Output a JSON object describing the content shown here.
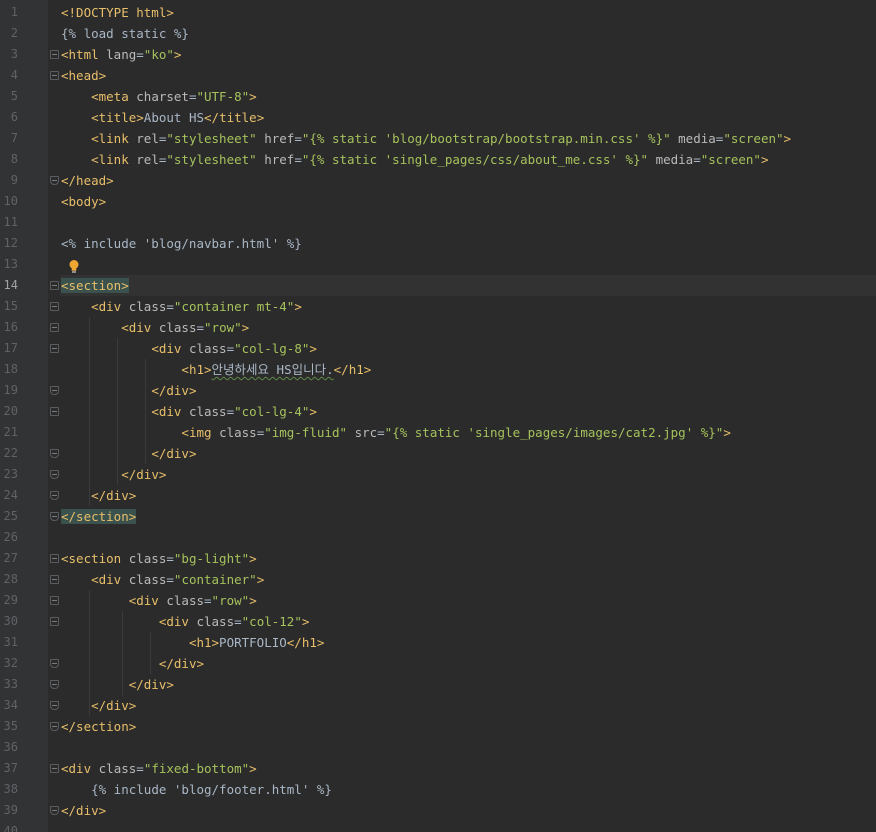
{
  "editor": {
    "current_line": 14,
    "lines": [
      {
        "n": "1",
        "tokens": [
          {
            "t": "<!DOCTYPE html>",
            "c": "tag"
          }
        ]
      },
      {
        "n": "2",
        "tokens": [
          {
            "t": "{% load static %}",
            "c": "tpl"
          }
        ]
      },
      {
        "n": "3",
        "tokens": [
          {
            "t": "<html ",
            "c": "tag"
          },
          {
            "t": "lang",
            "c": "attr"
          },
          {
            "t": "=",
            "c": "text"
          },
          {
            "t": "\"ko\"",
            "c": "str"
          },
          {
            "t": ">",
            "c": "tag"
          }
        ]
      },
      {
        "n": "4",
        "tokens": [
          {
            "t": "<head>",
            "c": "tag"
          }
        ]
      },
      {
        "n": "5",
        "tokens": [
          {
            "t": "    ",
            "c": "text"
          },
          {
            "t": "<meta ",
            "c": "tag"
          },
          {
            "t": "charset",
            "c": "attr"
          },
          {
            "t": "=",
            "c": "text"
          },
          {
            "t": "\"UTF-8\"",
            "c": "str"
          },
          {
            "t": ">",
            "c": "tag"
          }
        ]
      },
      {
        "n": "6",
        "tokens": [
          {
            "t": "    ",
            "c": "text"
          },
          {
            "t": "<title>",
            "c": "tag"
          },
          {
            "t": "About HS",
            "c": "text"
          },
          {
            "t": "</title>",
            "c": "tag"
          }
        ]
      },
      {
        "n": "7",
        "tokens": [
          {
            "t": "    ",
            "c": "text"
          },
          {
            "t": "<link ",
            "c": "tag"
          },
          {
            "t": "rel",
            "c": "attr"
          },
          {
            "t": "=",
            "c": "text"
          },
          {
            "t": "\"stylesheet\"",
            "c": "str"
          },
          {
            "t": " ",
            "c": "text"
          },
          {
            "t": "href",
            "c": "attr"
          },
          {
            "t": "=",
            "c": "text"
          },
          {
            "t": "\"{% static 'blog/bootstrap/bootstrap.min.css' %}\"",
            "c": "str"
          },
          {
            "t": " ",
            "c": "text"
          },
          {
            "t": "media",
            "c": "attr"
          },
          {
            "t": "=",
            "c": "text"
          },
          {
            "t": "\"screen\"",
            "c": "str"
          },
          {
            "t": ">",
            "c": "tag"
          }
        ]
      },
      {
        "n": "8",
        "tokens": [
          {
            "t": "    ",
            "c": "text"
          },
          {
            "t": "<link ",
            "c": "tag"
          },
          {
            "t": "rel",
            "c": "attr"
          },
          {
            "t": "=",
            "c": "text"
          },
          {
            "t": "\"stylesheet\"",
            "c": "str"
          },
          {
            "t": " ",
            "c": "text"
          },
          {
            "t": "href",
            "c": "attr"
          },
          {
            "t": "=",
            "c": "text"
          },
          {
            "t": "\"{% static 'single_pages/css/about_me.css' %}\"",
            "c": "str"
          },
          {
            "t": " ",
            "c": "text"
          },
          {
            "t": "media",
            "c": "attr"
          },
          {
            "t": "=",
            "c": "text"
          },
          {
            "t": "\"screen\"",
            "c": "str"
          },
          {
            "t": ">",
            "c": "tag"
          }
        ]
      },
      {
        "n": "9",
        "tokens": [
          {
            "t": "</head>",
            "c": "tag"
          }
        ]
      },
      {
        "n": "10",
        "tokens": [
          {
            "t": "<body>",
            "c": "tag"
          }
        ]
      },
      {
        "n": "11",
        "tokens": []
      },
      {
        "n": "12",
        "tokens": [
          {
            "t": "<% include 'blog/navbar.html' %}",
            "c": "tpl"
          }
        ]
      },
      {
        "n": "13",
        "tokens": []
      },
      {
        "n": "14",
        "tokens": [
          {
            "t": "<section>",
            "c": "hl"
          }
        ]
      },
      {
        "n": "15",
        "tokens": [
          {
            "t": "    ",
            "c": "text"
          },
          {
            "t": "<div ",
            "c": "tag"
          },
          {
            "t": "class",
            "c": "attr"
          },
          {
            "t": "=",
            "c": "text"
          },
          {
            "t": "\"container mt-4\"",
            "c": "str"
          },
          {
            "t": ">",
            "c": "tag"
          }
        ]
      },
      {
        "n": "16",
        "tokens": [
          {
            "t": "        ",
            "c": "text"
          },
          {
            "t": "<div ",
            "c": "tag"
          },
          {
            "t": "class",
            "c": "attr"
          },
          {
            "t": "=",
            "c": "text"
          },
          {
            "t": "\"row\"",
            "c": "str"
          },
          {
            "t": ">",
            "c": "tag"
          }
        ]
      },
      {
        "n": "17",
        "tokens": [
          {
            "t": "            ",
            "c": "text"
          },
          {
            "t": "<div ",
            "c": "tag"
          },
          {
            "t": "class",
            "c": "attr"
          },
          {
            "t": "=",
            "c": "text"
          },
          {
            "t": "\"col-lg-8\"",
            "c": "str"
          },
          {
            "t": ">",
            "c": "tag"
          }
        ]
      },
      {
        "n": "18",
        "tokens": [
          {
            "t": "                ",
            "c": "text"
          },
          {
            "t": "<h1>",
            "c": "tag"
          },
          {
            "t": "안녕하세요 HS입니다.",
            "c": "typo"
          },
          {
            "t": "</h1>",
            "c": "tag"
          }
        ]
      },
      {
        "n": "19",
        "tokens": [
          {
            "t": "            ",
            "c": "text"
          },
          {
            "t": "</div>",
            "c": "tag"
          }
        ]
      },
      {
        "n": "20",
        "tokens": [
          {
            "t": "            ",
            "c": "text"
          },
          {
            "t": "<div ",
            "c": "tag"
          },
          {
            "t": "class",
            "c": "attr"
          },
          {
            "t": "=",
            "c": "text"
          },
          {
            "t": "\"col-lg-4\"",
            "c": "str"
          },
          {
            "t": ">",
            "c": "tag"
          }
        ]
      },
      {
        "n": "21",
        "tokens": [
          {
            "t": "                ",
            "c": "text"
          },
          {
            "t": "<img ",
            "c": "tag"
          },
          {
            "t": "class",
            "c": "attr"
          },
          {
            "t": "=",
            "c": "text"
          },
          {
            "t": "\"img-fluid\"",
            "c": "str"
          },
          {
            "t": " ",
            "c": "text"
          },
          {
            "t": "src",
            "c": "attr"
          },
          {
            "t": "=",
            "c": "text"
          },
          {
            "t": "\"{% static 'single_pages/images/cat2.jpg' %}\"",
            "c": "str"
          },
          {
            "t": ">",
            "c": "tag"
          }
        ]
      },
      {
        "n": "22",
        "tokens": [
          {
            "t": "            ",
            "c": "text"
          },
          {
            "t": "</div>",
            "c": "tag"
          }
        ]
      },
      {
        "n": "23",
        "tokens": [
          {
            "t": "        ",
            "c": "text"
          },
          {
            "t": "</div>",
            "c": "tag"
          }
        ]
      },
      {
        "n": "24",
        "tokens": [
          {
            "t": "    ",
            "c": "text"
          },
          {
            "t": "</div>",
            "c": "tag"
          }
        ]
      },
      {
        "n": "25",
        "tokens": [
          {
            "t": "</section>",
            "c": "hl"
          }
        ]
      },
      {
        "n": "26",
        "tokens": []
      },
      {
        "n": "27",
        "tokens": [
          {
            "t": "<section ",
            "c": "tag"
          },
          {
            "t": "class",
            "c": "attr"
          },
          {
            "t": "=",
            "c": "text"
          },
          {
            "t": "\"bg-light\"",
            "c": "str"
          },
          {
            "t": ">",
            "c": "tag"
          }
        ]
      },
      {
        "n": "28",
        "tokens": [
          {
            "t": "    ",
            "c": "text"
          },
          {
            "t": "<div ",
            "c": "tag"
          },
          {
            "t": "class",
            "c": "attr"
          },
          {
            "t": "=",
            "c": "text"
          },
          {
            "t": "\"container\"",
            "c": "str"
          },
          {
            "t": ">",
            "c": "tag"
          }
        ]
      },
      {
        "n": "29",
        "tokens": [
          {
            "t": "         ",
            "c": "text"
          },
          {
            "t": "<div ",
            "c": "tag"
          },
          {
            "t": "class",
            "c": "attr"
          },
          {
            "t": "=",
            "c": "text"
          },
          {
            "t": "\"row\"",
            "c": "str"
          },
          {
            "t": ">",
            "c": "tag"
          }
        ]
      },
      {
        "n": "30",
        "tokens": [
          {
            "t": "             ",
            "c": "text"
          },
          {
            "t": "<div ",
            "c": "tag"
          },
          {
            "t": "class",
            "c": "attr"
          },
          {
            "t": "=",
            "c": "text"
          },
          {
            "t": "\"col-12\"",
            "c": "str"
          },
          {
            "t": ">",
            "c": "tag"
          }
        ]
      },
      {
        "n": "31",
        "tokens": [
          {
            "t": "                 ",
            "c": "text"
          },
          {
            "t": "<h1>",
            "c": "tag"
          },
          {
            "t": "PORTFOLIO",
            "c": "text"
          },
          {
            "t": "</h1>",
            "c": "tag"
          }
        ]
      },
      {
        "n": "32",
        "tokens": [
          {
            "t": "             ",
            "c": "text"
          },
          {
            "t": "</div>",
            "c": "tag"
          }
        ]
      },
      {
        "n": "33",
        "tokens": [
          {
            "t": "         ",
            "c": "text"
          },
          {
            "t": "</div>",
            "c": "tag"
          }
        ]
      },
      {
        "n": "34",
        "tokens": [
          {
            "t": "    ",
            "c": "text"
          },
          {
            "t": "</div>",
            "c": "tag"
          }
        ]
      },
      {
        "n": "35",
        "tokens": [
          {
            "t": "</section>",
            "c": "tag"
          }
        ]
      },
      {
        "n": "36",
        "tokens": []
      },
      {
        "n": "37",
        "tokens": [
          {
            "t": "<div ",
            "c": "tag"
          },
          {
            "t": "class",
            "c": "attr"
          },
          {
            "t": "=",
            "c": "text"
          },
          {
            "t": "\"fixed-bottom\"",
            "c": "str"
          },
          {
            "t": ">",
            "c": "tag"
          }
        ]
      },
      {
        "n": "38",
        "tokens": [
          {
            "t": "    ",
            "c": "text"
          },
          {
            "t": "{% include 'blog/footer.html' %}",
            "c": "tpl"
          }
        ]
      },
      {
        "n": "39",
        "tokens": [
          {
            "t": "</div>",
            "c": "tag"
          }
        ]
      },
      {
        "n": "40",
        "tokens": []
      }
    ],
    "fold_markers": [
      3,
      4,
      9,
      14,
      15,
      16,
      17,
      19,
      20,
      22,
      23,
      24,
      25,
      27,
      28,
      29,
      30,
      32,
      33,
      34,
      35,
      37,
      39
    ],
    "fold_ends": [
      9,
      19,
      22,
      23,
      24,
      25,
      32,
      33,
      34,
      35,
      39
    ],
    "intention_bulb_line": 13,
    "intention_bulb_icon": "lightbulb-icon",
    "colors": {
      "background": "#2b2b2b",
      "gutter": "#313335",
      "tag": "#e8bf6a",
      "attribute": "#bababa",
      "string": "#a5c25c",
      "text": "#a9b7c6",
      "line_number": "#606366",
      "tag_highlight": "#3b514d"
    }
  }
}
